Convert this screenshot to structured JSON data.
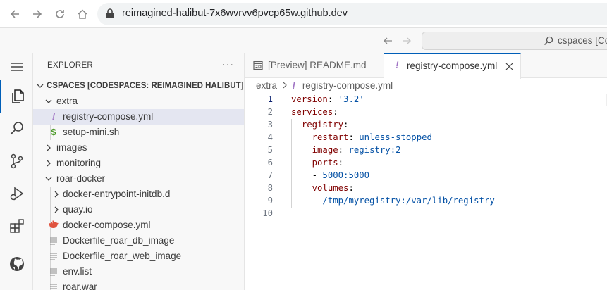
{
  "browser": {
    "url": "reimagined-halibut-7x6wvrvv6pvcp65w.github.dev"
  },
  "titlebar": {
    "command_center_text": "cspaces [Co"
  },
  "explorer": {
    "title": "EXPLORER",
    "more_label": "···",
    "root_label": "CSPACES [CODESPACES: REIMAGINED HALIBUT]",
    "items": [
      {
        "label": "extra",
        "kind": "folder",
        "expanded": true
      },
      {
        "label": "registry-compose.yml",
        "kind": "yaml",
        "selected": true
      },
      {
        "label": "setup-mini.sh",
        "kind": "shell"
      },
      {
        "label": "images",
        "kind": "folder",
        "expanded": false
      },
      {
        "label": "monitoring",
        "kind": "folder",
        "expanded": false
      },
      {
        "label": "roar-docker",
        "kind": "folder",
        "expanded": true
      },
      {
        "label": "docker-entrypoint-initdb.d",
        "kind": "folder",
        "expanded": false
      },
      {
        "label": "quay.io",
        "kind": "folder",
        "expanded": false
      },
      {
        "label": "docker-compose.yml",
        "kind": "docker"
      },
      {
        "label": "Dockerfile_roar_db_image",
        "kind": "file"
      },
      {
        "label": "Dockerfile_roar_web_image",
        "kind": "file"
      },
      {
        "label": "env.list",
        "kind": "file"
      },
      {
        "label": "roar.war",
        "kind": "file"
      }
    ]
  },
  "editor": {
    "tabs": [
      {
        "label": "[Preview] README.md",
        "active": false
      },
      {
        "label": "registry-compose.yml",
        "active": true
      }
    ],
    "breadcrumb": {
      "folder": "extra",
      "file": "registry-compose.yml"
    },
    "lines": [
      {
        "num": "1",
        "key": "version",
        "value": "'3.2'"
      },
      {
        "num": "2",
        "key": "services",
        "value": ""
      },
      {
        "num": "3",
        "key": "registry",
        "value": ""
      },
      {
        "num": "4",
        "key": "restart",
        "value": "unless-stopped"
      },
      {
        "num": "5",
        "key": "image",
        "value": "registry:2"
      },
      {
        "num": "6",
        "key": "ports",
        "value": ""
      },
      {
        "num": "7",
        "key": "",
        "value": "5000:5000"
      },
      {
        "num": "8",
        "key": "volumes",
        "value": ""
      },
      {
        "num": "9",
        "key": "",
        "value": "/tmp/myregistry:/var/lib/registry"
      },
      {
        "num": "10",
        "key": "",
        "value": ""
      }
    ]
  },
  "colors": {
    "accent": "#005fb8",
    "yaml_key": "#800000",
    "yaml_value": "#0451a5",
    "yaml_icon": "#a074c4",
    "shell_icon": "#4d9a2a",
    "docker_icon": "#e0533f"
  }
}
